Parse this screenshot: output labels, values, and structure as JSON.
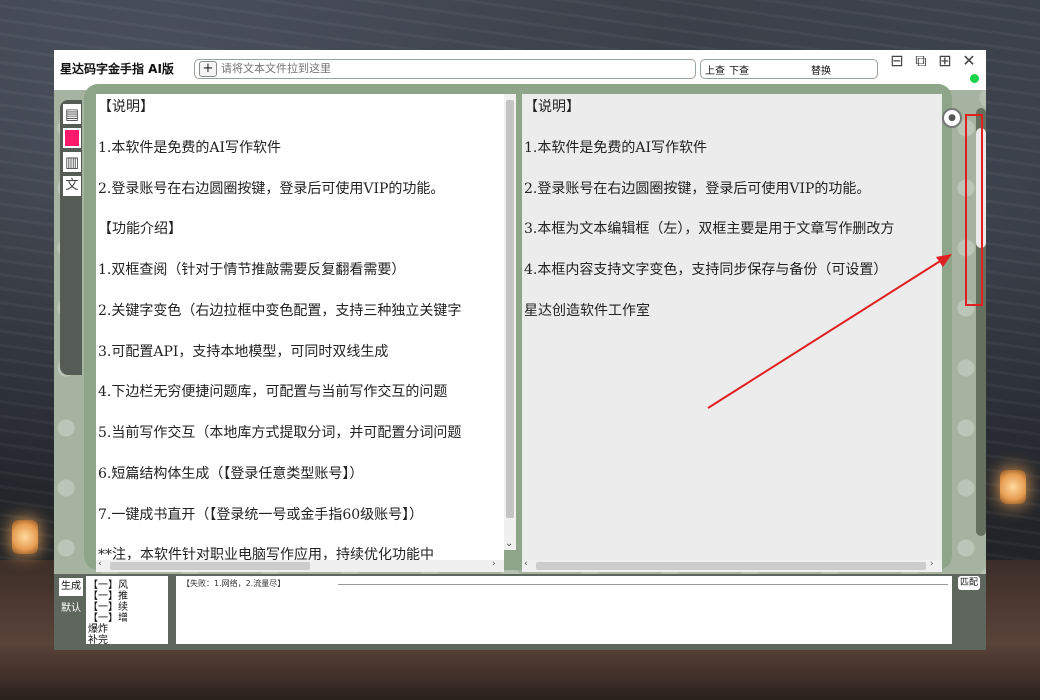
{
  "app": {
    "title": "星达码字金手指 AI版"
  },
  "toolbar": {
    "add_label": "+",
    "path_placeholder": "请将文本文件拉到这里",
    "search_up": "上查",
    "search_down": "下查",
    "replace": "替换"
  },
  "window_controls": [
    "minimize-icon",
    "restore-icon",
    "maximize-icon",
    "close-icon"
  ],
  "window_symbols": {
    "minimize": "⊟",
    "restore": "⧉",
    "maximize": "⊞",
    "close": "✕"
  },
  "left_rail": {
    "text_icon_label": "文"
  },
  "left_pane": {
    "lines": [
      "【说明】",
      "1.本软件是免费的AI写作软件",
      "2.登录账号在右边圆圈按键，登录后可使用VIP的功能。",
      "【功能介绍】",
      "1.双框查阅（针对于情节推敲需要反复翻看需要）",
      "2.关键字变色（右边拉框中变色配置，支持三种独立关键字",
      "3.可配置API，支持本地模型，可同时双线生成",
      "4.下边栏无穷便捷问题库，可配置与当前写作交互的问题",
      "5.当前写作交互（本地库方式提取分词，并可配置分词问题",
      "6.短篇结构体生成（【登录任意类型账号】）",
      "7.一键成书直开（【登录统一号或金手指60级账号】）",
      "**注，本软件针对职业电脑写作应用，持续优化功能中"
    ]
  },
  "right_pane": {
    "lines": [
      "【说明】",
      "1.本软件是免费的AI写作软件",
      "2.登录账号在右边圆圈按键，登录后可使用VIP的功能。",
      "3.本框为文本编辑框（左），双框主要是用于文章写作删改方",
      "4.本框内容支持文字变色，支持同步保存与备份（可设置）",
      "星达创造软件工作室"
    ]
  },
  "scroll_arrows": {
    "left": "‹",
    "right": "›",
    "down": "⌄"
  },
  "bottom": {
    "gen_tab": "生成",
    "default_tab": "默认",
    "list_items": [
      "【一】风",
      "【一】推",
      "【一】续",
      "【一】增",
      "爆炸",
      "补完"
    ],
    "output_header": "【失败：1.网络，2.流量尽】",
    "match_button": "匹配"
  },
  "colors": {
    "status": "#17d34a",
    "annotation": "#e02020",
    "frame": "#8ea589"
  }
}
